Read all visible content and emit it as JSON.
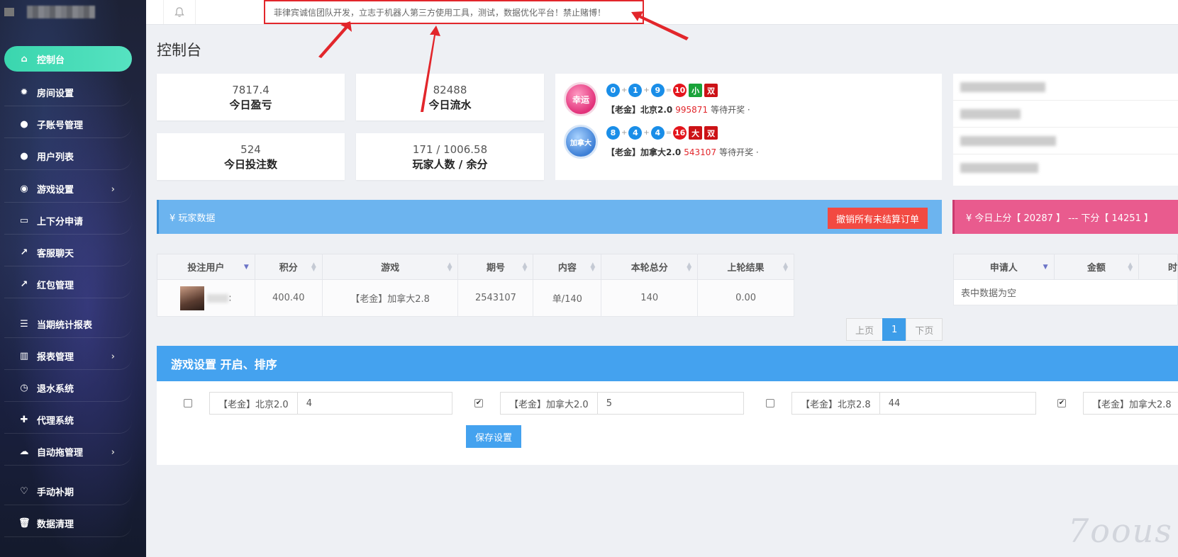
{
  "topbar": {
    "notice": "菲律宾诚信团队开发，立志于机器人第三方使用工具，测试，数据优化平台！禁止赌博！"
  },
  "sidebar": {
    "items": [
      {
        "label": "控制台",
        "icon": "home-icon",
        "glyph": "⌂"
      },
      {
        "label": "房间设置",
        "icon": "gear-icon",
        "glyph": "✹"
      },
      {
        "label": "子账号管理",
        "icon": "user-icon",
        "glyph": "●"
      },
      {
        "label": "用户列表",
        "icon": "user-icon",
        "glyph": "●"
      },
      {
        "label": "游戏设置",
        "icon": "gamepad-icon",
        "glyph": "◉"
      },
      {
        "label": "上下分申请",
        "icon": "card-icon",
        "glyph": "▭"
      },
      {
        "label": "客服聊天",
        "icon": "share-icon",
        "glyph": "↗"
      },
      {
        "label": "红包管理",
        "icon": "share-icon",
        "glyph": "↗"
      },
      {
        "label": "当期统计报表",
        "icon": "list-icon",
        "glyph": "☰"
      },
      {
        "label": "报表管理",
        "icon": "bar-chart-icon",
        "glyph": "▥"
      },
      {
        "label": "退水系统",
        "icon": "clock-icon",
        "glyph": "◷"
      },
      {
        "label": "代理系统",
        "icon": "add-user-icon",
        "glyph": "✚"
      },
      {
        "label": "自动拖管理",
        "icon": "cloud-icon",
        "glyph": "☁"
      },
      {
        "label": "手动补期",
        "icon": "heart-icon",
        "glyph": "♡"
      },
      {
        "label": "数据清理",
        "icon": "trash-icon",
        "glyph": "🗑"
      }
    ]
  },
  "page": {
    "title": "控制台"
  },
  "stats": [
    {
      "value": "7817.4",
      "label": "今日盈亏"
    },
    {
      "value": "82488",
      "label": "今日流水"
    },
    {
      "value": "524",
      "label": "今日投注数"
    },
    {
      "value": "171 / 1006.58",
      "label": "玩家人数 / 余分"
    }
  ],
  "lottery": [
    {
      "badge": "幸运",
      "balls": [
        "0",
        "1",
        "9"
      ],
      "sum": "10",
      "tags": [
        "小",
        "双"
      ],
      "name": "【老金】北京2.0",
      "issue": "995871",
      "status": "等待开奖 ·"
    },
    {
      "badge": "加拿大",
      "balls": [
        "8",
        "4",
        "4"
      ],
      "sum": "16",
      "tags": [
        "大",
        "双"
      ],
      "name": "【老金】加拿大2.0",
      "issue": "543107",
      "status": "等待开奖 ·"
    }
  ],
  "ops": {
    "plus": "+",
    "equals": "="
  },
  "player_panel": {
    "title": "¥ 玩家数据",
    "cancel_label": "撤销所有未结算订单",
    "columns": [
      "投注用户",
      "积分",
      "游戏",
      "期号",
      "内容",
      "本轮总分",
      "上轮结果"
    ],
    "rows": [
      {
        "user_suffix": ":",
        "score": "400.40",
        "game": "【老金】加拿大2.8",
        "issue": "2543107",
        "content": "单/140",
        "total": "140",
        "last": "0.00"
      }
    ]
  },
  "pager": {
    "prev": "上页",
    "current": "1",
    "next": "下页"
  },
  "updown_panel": {
    "title": "¥ 今日上分【 20287 】 --- 下分【 14251 】",
    "columns": [
      "申请人",
      "金额",
      "时"
    ],
    "empty": "表中数据为空"
  },
  "game_settings": {
    "title": "游戏设置 开启、排序",
    "items": [
      {
        "label": "【老金】北京2.0",
        "value": "4",
        "checked": false
      },
      {
        "label": "【老金】加拿大2.0",
        "value": "5",
        "checked": true
      },
      {
        "label": "【老金】北京2.8",
        "value": "44",
        "checked": false
      },
      {
        "label": "【老金】加拿大2.8",
        "value": "",
        "checked": true
      }
    ],
    "save_label": "保存设置"
  },
  "watermark": "7oous",
  "colors": {
    "accent": "#44a2ef",
    "active_nav": "#3ad6ae",
    "danger": "#f24a42",
    "pink": "#e95b8e",
    "annotation": "#e2262b"
  }
}
